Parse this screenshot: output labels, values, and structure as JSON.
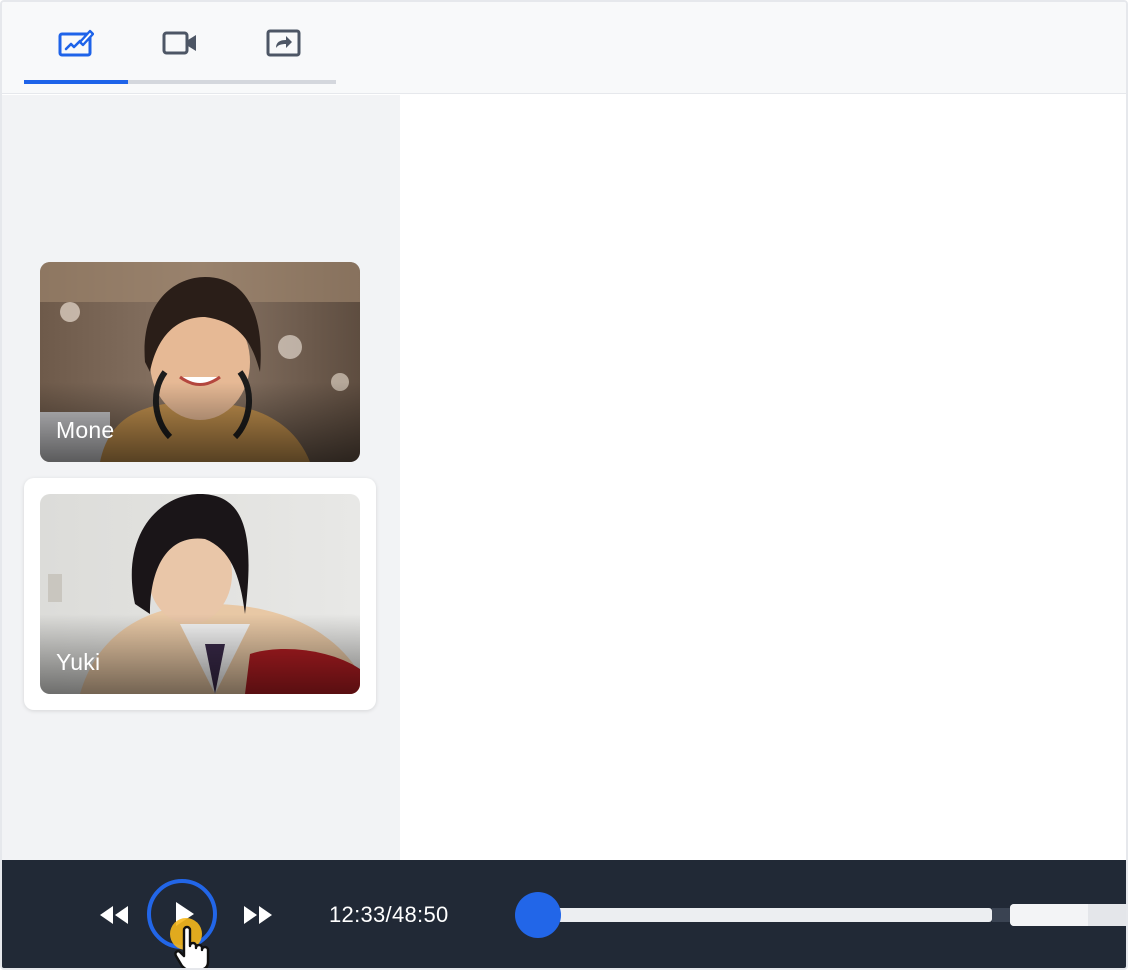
{
  "toolbar": {
    "tabs": [
      {
        "icon": "whiteboard-pen-icon",
        "active": true
      },
      {
        "icon": "video-camera-icon",
        "active": false
      },
      {
        "icon": "share-screen-icon",
        "active": false
      }
    ],
    "accent": "#1e63e9"
  },
  "participants": [
    {
      "name": "Mone",
      "selected": false
    },
    {
      "name": "Yuki",
      "selected": true
    }
  ],
  "player": {
    "time": "12:33/48:50",
    "progress": 0.0,
    "volume": 0.65,
    "controls": [
      "rewind-icon",
      "play-icon",
      "fast-forward-icon"
    ]
  }
}
